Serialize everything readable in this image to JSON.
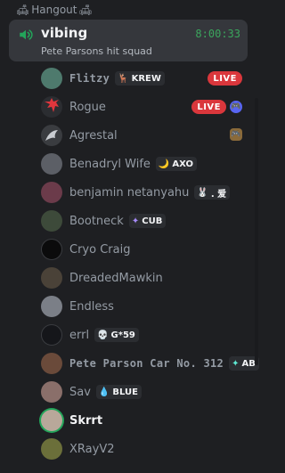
{
  "header": {
    "title": "Hangout",
    "left_emoji": "🛋",
    "right_emoji": "🛋"
  },
  "voice_channel": {
    "name": "vibing",
    "timer": "8:00:33",
    "status": "Pete Parsons hit squad"
  },
  "colors": {
    "speaking": "#23a55a",
    "live": "#da373c",
    "timer": "#3ba55d"
  },
  "members": [
    {
      "name": "Flitzy",
      "tag": "KREW",
      "tag_icon": "🦌",
      "live": "LIVE"
    },
    {
      "name": "Rogue",
      "live": "LIVE",
      "activity": "🎮"
    },
    {
      "name": "Agrestal",
      "activity": "🎮"
    },
    {
      "name": "Benadryl Wife",
      "tag": "AXO",
      "tag_icon": "🌙"
    },
    {
      "name": "benjamin netanyahu",
      "tag": ". 爱",
      "tag_icon": "🐰"
    },
    {
      "name": "Bootneck",
      "tag": "CUB",
      "tag_icon": "✦"
    },
    {
      "name": "Cryo Craig"
    },
    {
      "name": "DreadedMawkin"
    },
    {
      "name": "Endless"
    },
    {
      "name": "errl",
      "tag": "G*59",
      "tag_icon": "💀"
    },
    {
      "name": "Pete Parson Car No. 312",
      "tag": "AB",
      "tag_icon": "✦"
    },
    {
      "name": "Sav",
      "tag": "BLUE",
      "tag_icon": "💧"
    },
    {
      "name": "Skrrt"
    },
    {
      "name": "XRayV2"
    }
  ]
}
